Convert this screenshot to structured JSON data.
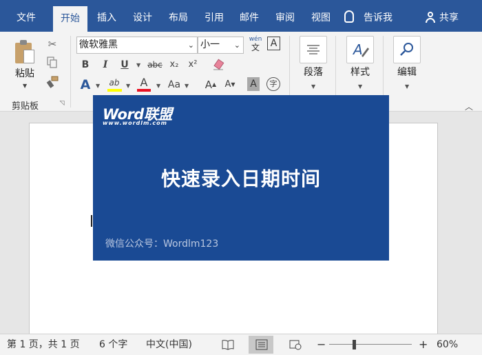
{
  "tabs": [
    {
      "label": "文件",
      "active": false
    },
    {
      "label": "开始",
      "active": true
    },
    {
      "label": "插入",
      "active": false
    },
    {
      "label": "设计",
      "active": false
    },
    {
      "label": "布局",
      "active": false
    },
    {
      "label": "引用",
      "active": false
    },
    {
      "label": "邮件",
      "active": false
    },
    {
      "label": "审阅",
      "active": false
    },
    {
      "label": "视图",
      "active": false
    }
  ],
  "tell_me": "告诉我",
  "share": "共享",
  "clipboard": {
    "paste_label": "粘贴",
    "group_label": "剪贴板"
  },
  "font": {
    "font_name": "微软雅黑",
    "font_size": "小一",
    "phonetic_top": "wén",
    "phonetic_bottom": "文",
    "border_char": "A",
    "bold": "B",
    "italic": "I",
    "underline": "U",
    "strikethrough": "abc",
    "subscript": "x₂",
    "superscript": "x²",
    "text_effects": "A",
    "highlight": "ab",
    "font_color": "A",
    "change_case": "Aa",
    "grow": "A",
    "shrink": "A",
    "char_shading": "A",
    "enclose": "字",
    "colors": {
      "highlight": "#ffff00",
      "font_color": "#e81123",
      "effects": "#2b579a"
    }
  },
  "paragraph_label": "段落",
  "styles_label": "样式",
  "editing_label": "编辑",
  "banner": {
    "logo_word": "Word",
    "logo_cn": "联盟",
    "logo_url": "www.wordlm.com",
    "title": "快速录入日期时间",
    "footer": "微信公众号：Wordlm123",
    "bg_color": "#1a4a94"
  },
  "status": {
    "page": "第 1 页，共 1 页",
    "words": "6 个字",
    "language": "中文(中国)",
    "zoom_minus": "−",
    "zoom_plus": "+",
    "zoom": "60%",
    "zoom_level": 0.3
  },
  "accent_color": "#2b579a"
}
